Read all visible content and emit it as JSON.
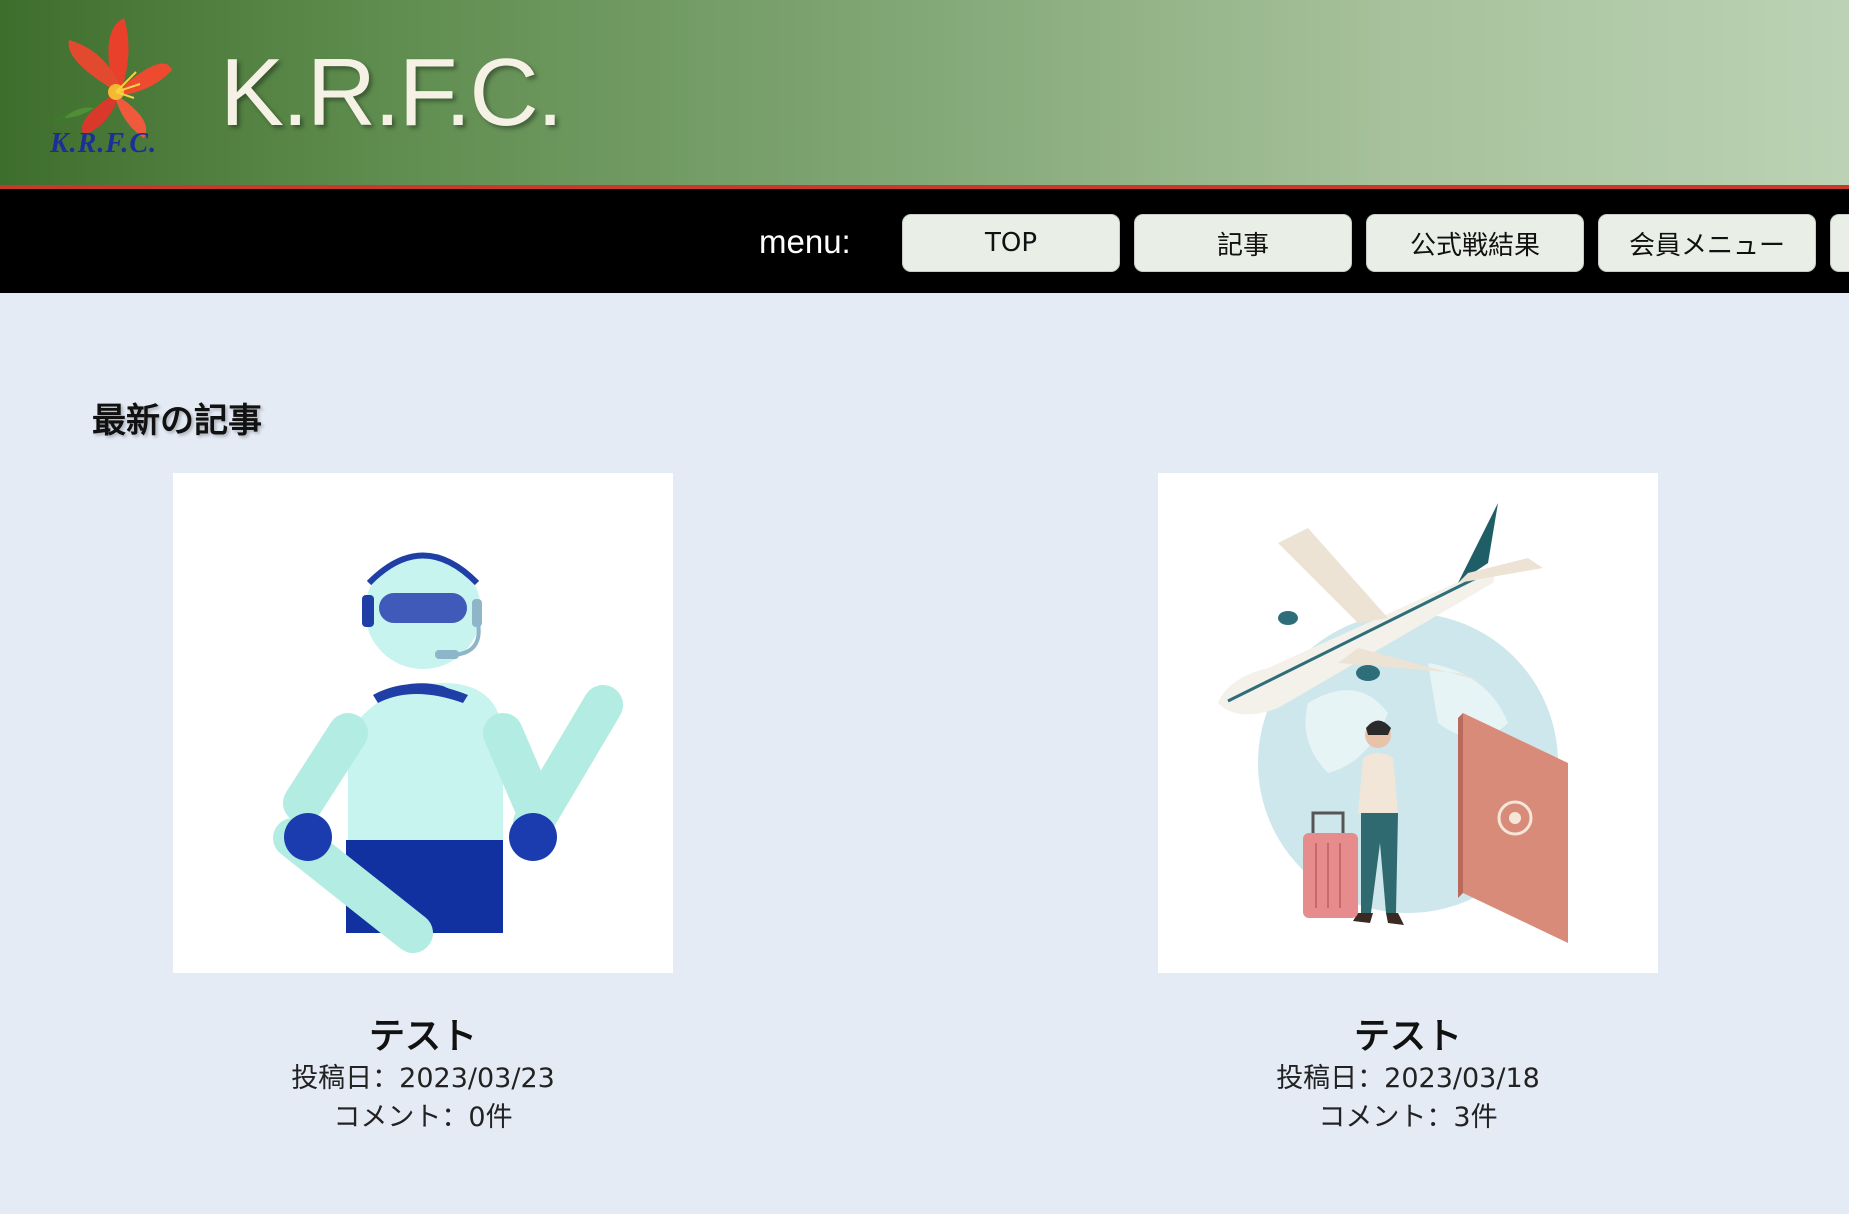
{
  "header": {
    "logo_text": "K.R.F.C.",
    "site_title": "K.R.F.C."
  },
  "menu": {
    "label": "menu:",
    "items": [
      {
        "label": "TOP"
      },
      {
        "label": "記事"
      },
      {
        "label": "公式戦結果"
      },
      {
        "label": "会員メニュー"
      },
      {
        "label": ""
      }
    ]
  },
  "main": {
    "section_title": "最新の記事",
    "articles": [
      {
        "title": "テスト",
        "posted": "投稿日：2023/03/23",
        "comments": "コメント：0件",
        "image": "robot-illustration"
      },
      {
        "title": "テスト",
        "posted": "投稿日：2023/03/18",
        "comments": "コメント：3件",
        "image": "travel-illustration"
      }
    ]
  },
  "colors": {
    "header_dark": "#3e6e2c",
    "header_light": "#bcd2b4",
    "header_border": "#c8392b",
    "menubar": "#000000",
    "button_bg": "#e9eee6",
    "page_bg": "#e4ebf5"
  }
}
